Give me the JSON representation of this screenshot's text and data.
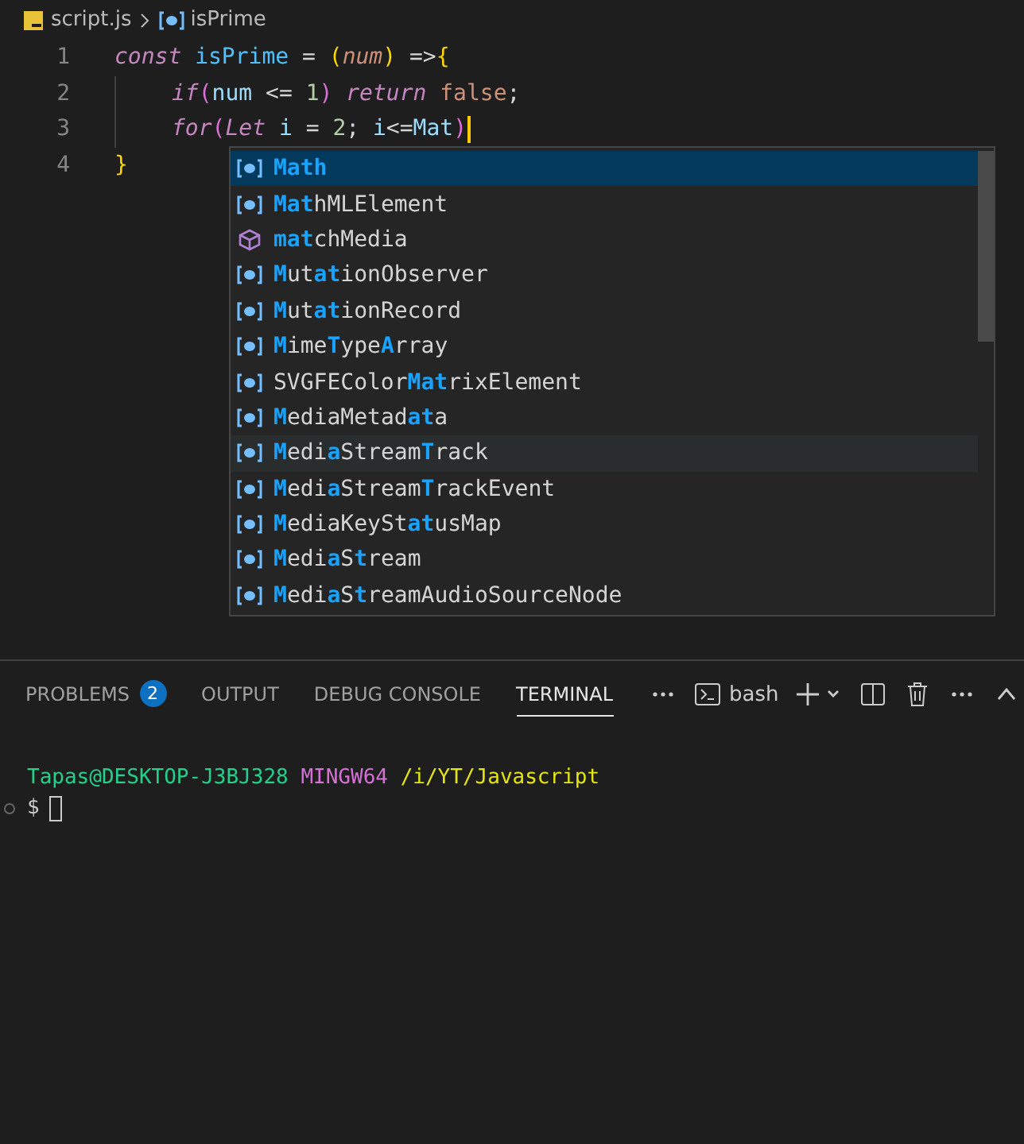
{
  "breadcrumb": {
    "file": "script.js",
    "symbol": "isPrime"
  },
  "editor": {
    "lines": [
      {
        "number": "1",
        "tokens": [
          {
            "kind": "keyword",
            "text": "const "
          },
          {
            "kind": "name",
            "text": "isPrime"
          },
          {
            "kind": "op",
            "text": " = "
          },
          {
            "kind": "paren",
            "text": "("
          },
          {
            "kind": "param",
            "text": "num"
          },
          {
            "kind": "paren",
            "text": ")"
          },
          {
            "kind": "op",
            "text": " =>"
          },
          {
            "kind": "paren",
            "text": "{"
          }
        ],
        "children": [
          {
            "number": "2",
            "tokens": [
              {
                "kind": "keyword",
                "text": "if"
              },
              {
                "kind": "bracket",
                "text": "("
              },
              {
                "kind": "variable",
                "text": "num"
              },
              {
                "kind": "op",
                "text": " <= "
              },
              {
                "kind": "number",
                "text": "1"
              },
              {
                "kind": "bracket",
                "text": ") "
              },
              {
                "kind": "keyword",
                "text": "return "
              },
              {
                "kind": "literal",
                "text": "false"
              },
              {
                "kind": "op",
                "text": ";"
              }
            ]
          },
          {
            "number": "3",
            "tokens": [
              {
                "kind": "keyword",
                "text": "for"
              },
              {
                "kind": "bracket",
                "text": "("
              },
              {
                "kind": "keyword",
                "text": "Let"
              },
              {
                "kind": "variable",
                "text": " i"
              },
              {
                "kind": "op",
                "text": " = "
              },
              {
                "kind": "number",
                "text": "2"
              },
              {
                "kind": "op",
                "text": "; "
              },
              {
                "kind": "variable",
                "text": "i"
              },
              {
                "kind": "op",
                "text": "<="
              },
              {
                "kind": "variable",
                "text": "Mat"
              },
              {
                "kind": "bracket",
                "text": ")"
              }
            ],
            "cursor": true
          }
        ]
      },
      {
        "number": "4",
        "tokens": [
          {
            "kind": "paren",
            "text": "}"
          }
        ]
      }
    ]
  },
  "suggestions": [
    {
      "kind": "variable",
      "selected": true,
      "hovered": false,
      "segments": [
        {
          "text": "Math",
          "match": true
        }
      ]
    },
    {
      "kind": "variable",
      "selected": false,
      "hovered": false,
      "segments": [
        {
          "text": "Mat",
          "match": true
        },
        {
          "text": "hMLElement",
          "match": false
        }
      ]
    },
    {
      "kind": "method",
      "selected": false,
      "hovered": false,
      "segments": [
        {
          "text": "mat",
          "match": true
        },
        {
          "text": "chMedia",
          "match": false
        }
      ]
    },
    {
      "kind": "variable",
      "selected": false,
      "hovered": false,
      "segments": [
        {
          "text": "M",
          "match": true
        },
        {
          "text": "ut",
          "match": false
        },
        {
          "text": "at",
          "match": true
        },
        {
          "text": "ionObserver",
          "match": false
        }
      ]
    },
    {
      "kind": "variable",
      "selected": false,
      "hovered": false,
      "segments": [
        {
          "text": "M",
          "match": true
        },
        {
          "text": "ut",
          "match": false
        },
        {
          "text": "at",
          "match": true
        },
        {
          "text": "ionRecord",
          "match": false
        }
      ]
    },
    {
      "kind": "variable",
      "selected": false,
      "hovered": false,
      "segments": [
        {
          "text": "M",
          "match": true
        },
        {
          "text": "ime",
          "match": false
        },
        {
          "text": "T",
          "match": true
        },
        {
          "text": "ype",
          "match": false
        },
        {
          "text": "A",
          "match": true
        },
        {
          "text": "rray",
          "match": false
        }
      ]
    },
    {
      "kind": "variable",
      "selected": false,
      "hovered": false,
      "segments": [
        {
          "text": "SVGFEColor",
          "match": false
        },
        {
          "text": "Mat",
          "match": true
        },
        {
          "text": "rixElement",
          "match": false
        }
      ]
    },
    {
      "kind": "variable",
      "selected": false,
      "hovered": false,
      "segments": [
        {
          "text": "M",
          "match": true
        },
        {
          "text": "ediaMetad",
          "match": false
        },
        {
          "text": "at",
          "match": true
        },
        {
          "text": "a",
          "match": false
        }
      ]
    },
    {
      "kind": "variable",
      "selected": false,
      "hovered": true,
      "segments": [
        {
          "text": "M",
          "match": true
        },
        {
          "text": "edi",
          "match": false
        },
        {
          "text": "a",
          "match": true
        },
        {
          "text": "Stream",
          "match": false
        },
        {
          "text": "T",
          "match": true
        },
        {
          "text": "rack",
          "match": false
        }
      ]
    },
    {
      "kind": "variable",
      "selected": false,
      "hovered": false,
      "segments": [
        {
          "text": "M",
          "match": true
        },
        {
          "text": "edi",
          "match": false
        },
        {
          "text": "a",
          "match": true
        },
        {
          "text": "Stream",
          "match": false
        },
        {
          "text": "T",
          "match": true
        },
        {
          "text": "rackEvent",
          "match": false
        }
      ]
    },
    {
      "kind": "variable",
      "selected": false,
      "hovered": false,
      "segments": [
        {
          "text": "M",
          "match": true
        },
        {
          "text": "ediaKeySt",
          "match": false
        },
        {
          "text": "at",
          "match": true
        },
        {
          "text": "usMap",
          "match": false
        }
      ]
    },
    {
      "kind": "variable",
      "selected": false,
      "hovered": false,
      "segments": [
        {
          "text": "M",
          "match": true
        },
        {
          "text": "edi",
          "match": false
        },
        {
          "text": "a",
          "match": true
        },
        {
          "text": "S",
          "match": false
        },
        {
          "text": "t",
          "match": true
        },
        {
          "text": "ream",
          "match": false
        }
      ]
    },
    {
      "kind": "variable",
      "selected": false,
      "hovered": false,
      "segments": [
        {
          "text": "M",
          "match": true
        },
        {
          "text": "edi",
          "match": false
        },
        {
          "text": "a",
          "match": true
        },
        {
          "text": "S",
          "match": false
        },
        {
          "text": "t",
          "match": true
        },
        {
          "text": "reamAudioSourceNode",
          "match": false
        }
      ]
    }
  ],
  "panel": {
    "tabs": [
      {
        "label": "PROBLEMS",
        "badge": "2",
        "selected": false
      },
      {
        "label": "OUTPUT",
        "selected": false
      },
      {
        "label": "DEBUG CONSOLE",
        "selected": false
      },
      {
        "label": "TERMINAL",
        "selected": true
      }
    ],
    "shell": "bash"
  },
  "terminal": {
    "user_host": "Tapas@DESKTOP-J3BJ328",
    "system": "MINGW64",
    "path": "/i/YT/Javascript",
    "prompt": "$"
  }
}
